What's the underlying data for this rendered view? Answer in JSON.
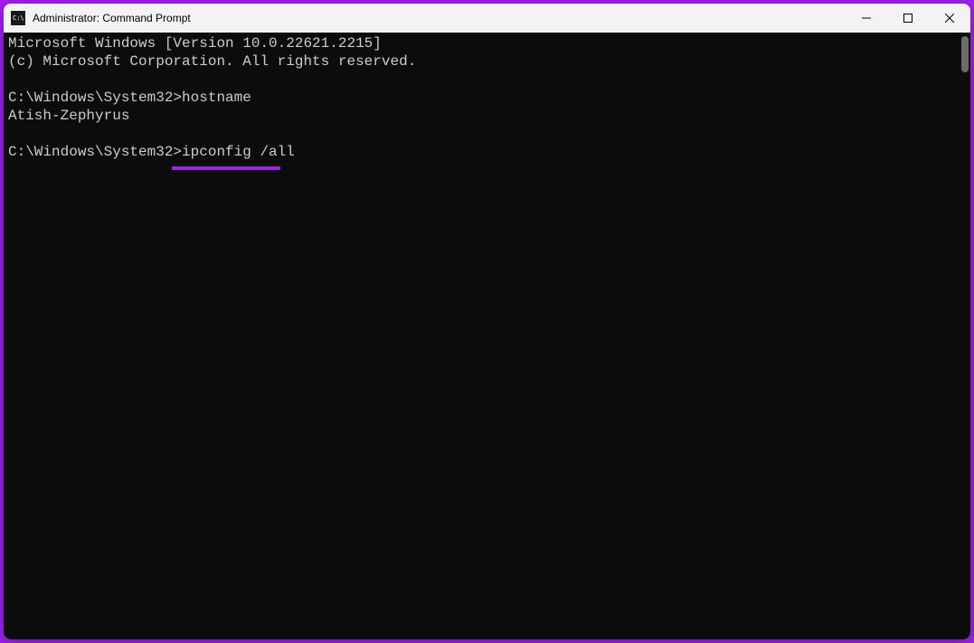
{
  "titlebar": {
    "title": "Administrator: Command Prompt"
  },
  "terminal": {
    "line1": "Microsoft Windows [Version 10.0.22621.2215]",
    "line2": "(c) Microsoft Corporation. All rights reserved.",
    "prompt1_path": "C:\\Windows\\System32>",
    "prompt1_cmd": "hostname",
    "output1": "Atish-Zephyrus",
    "prompt2_path": "C:\\Windows\\System32>",
    "prompt2_cmd": "ipconfig /all"
  },
  "colors": {
    "accent": "#a020f0",
    "terminal_bg": "#0c0c0c",
    "terminal_fg": "#cccccc"
  }
}
